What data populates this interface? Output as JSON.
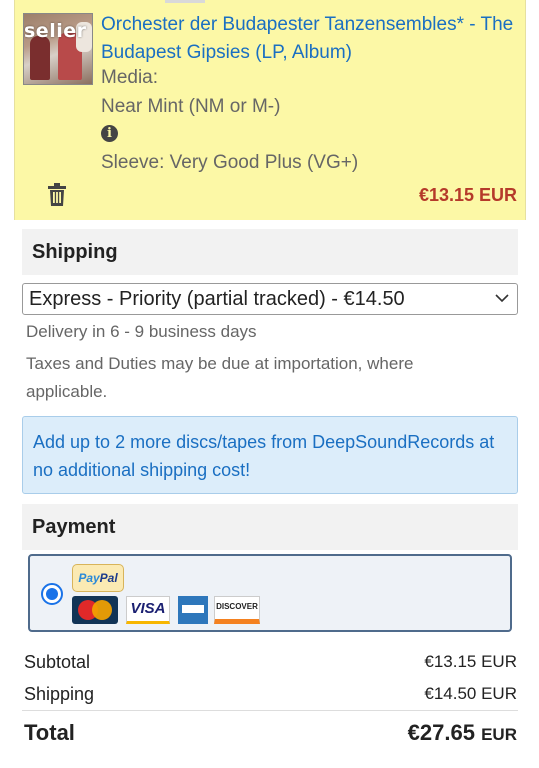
{
  "item": {
    "thumb_watermark": "selier",
    "title": "Orchester der Budapester Tanzensembles* - The Budapest Gipsies (LP, Album)",
    "media_label": "Media:",
    "media_condition": "Near Mint (NM or M-)",
    "sleeve": "Sleeve: Very Good Plus (VG+)",
    "price": "€13.15 EUR",
    "price_color": "#b53a2a"
  },
  "shipping": {
    "heading": "Shipping",
    "selected_option": "Express - Priority (partial tracked) - €14.50",
    "delivery": "Delivery in 6 - 9 business days",
    "taxes_note": "Taxes and Duties may be due at importation, where applicable.",
    "promo": "Add up to 2 more discs/tapes from DeepSoundRecords at no additional shipping cost!"
  },
  "payment": {
    "heading": "Payment",
    "paypal_logo_a": "Pay",
    "paypal_logo_b": "Pal",
    "visa_logo": "VISA",
    "discover_logo": "DISCOVER",
    "accent_color": "#1a73e8"
  },
  "totals": {
    "subtotal_label": "Subtotal",
    "subtotal_value": "€13.15 EUR",
    "shipping_label": "Shipping",
    "shipping_value": "€14.50 EUR",
    "total_label": "Total",
    "total_value": "€27.65",
    "total_currency": "EUR"
  }
}
